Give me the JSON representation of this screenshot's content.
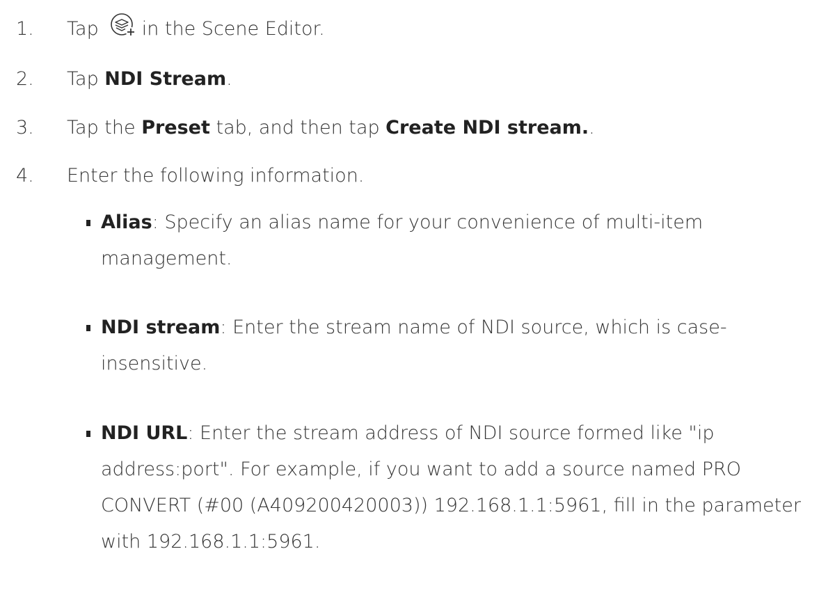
{
  "steps": [
    {
      "number": "1.",
      "before": "Tap",
      "icon": "add-layer-icon",
      "after": "in the Scene Editor."
    },
    {
      "number": "2.",
      "before": "Tap ",
      "bold": "NDI Stream",
      "after": "."
    },
    {
      "number": "3.",
      "before": "Tap the ",
      "bold1": "Preset",
      "middle": " tab, and then tap ",
      "bold2": "Create NDI stream.",
      "after": "."
    },
    {
      "number": "4.",
      "text": "Enter the following information."
    }
  ],
  "fields": [
    {
      "term": "Alias",
      "description": ": Specify an alias name for your convenience of multi-item management."
    },
    {
      "term": "NDI stream",
      "description": ": Enter the stream name of NDI source, which is case-insensitive."
    },
    {
      "term": "NDI URL",
      "description": ": Enter the stream address of NDI source formed like \"ip address:port\". For example, if you want to add a source named PRO CONVERT (#00 (A409200420003)) 192.168.1.1:5961, fill in the parameter with 192.168.1.1:5961."
    }
  ]
}
